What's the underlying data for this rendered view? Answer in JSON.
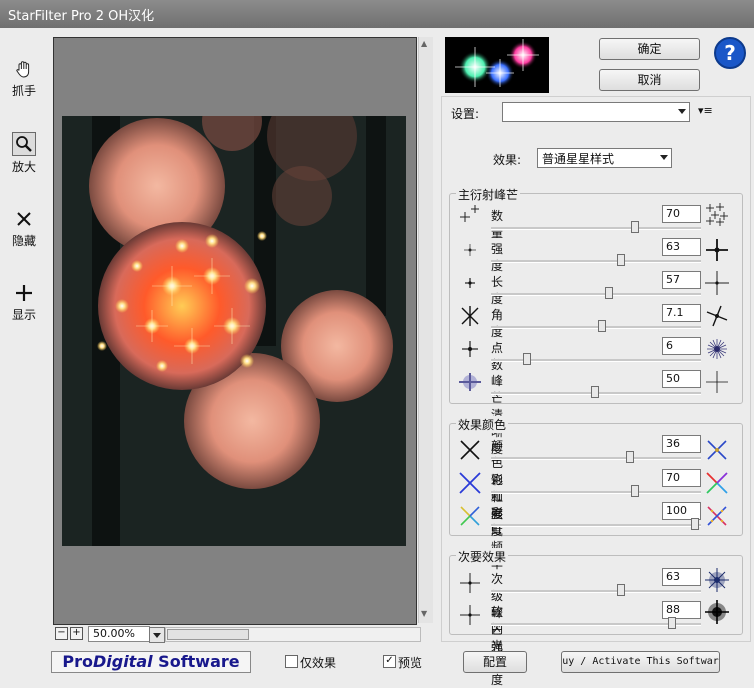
{
  "window": {
    "title": "StarFilter Pro 2 OH汉化"
  },
  "tools": [
    {
      "label": "抓手",
      "icon": "hand-icon"
    },
    {
      "label": "放大",
      "icon": "magnifier-icon"
    },
    {
      "label": "隐藏",
      "icon": "x-icon"
    },
    {
      "label": "显示",
      "icon": "plus-icon"
    }
  ],
  "zoom": {
    "value": "50.00%"
  },
  "buttons": {
    "ok": "确定",
    "cancel": "取消",
    "config": "配置",
    "activate": "uy / Activate This Softwar"
  },
  "settings": {
    "label": "设置:",
    "value": ""
  },
  "effect": {
    "label": "效果:",
    "value": "普通星星样式"
  },
  "groups": {
    "main": {
      "title": "主衍射峰芒",
      "rows": [
        {
          "label": "数量",
          "value": "70"
        },
        {
          "label": "强度",
          "value": "63"
        },
        {
          "label": "长度",
          "value": "57"
        },
        {
          "label": "角度",
          "value": "7.1"
        },
        {
          "label": "点数",
          "value": "6"
        },
        {
          "label": "峰芒清晰度",
          "value": "50"
        }
      ]
    },
    "color": {
      "title": "效果颜色",
      "rows": [
        {
          "label": "颜色饱和度",
          "value": "36"
        },
        {
          "label": "彩虹强度",
          "value": "70"
        },
        {
          "label": "彩虹频率",
          "value": "100"
        }
      ]
    },
    "secondary": {
      "title": "次要效果",
      "rows": [
        {
          "label": "次级峰芒强度",
          "value": "63"
        },
        {
          "label": "软闪光强度",
          "value": "88"
        }
      ]
    }
  },
  "footer": {
    "logo": {
      "pro": "Pro",
      "digital": "Digital",
      "software": " Software"
    },
    "effect_only": {
      "label": "仅效果",
      "checked": false
    },
    "preview": {
      "label": "预览",
      "checked": true
    }
  },
  "colors": {
    "accent": "#1a57c8",
    "logo_text": "#18188c"
  }
}
